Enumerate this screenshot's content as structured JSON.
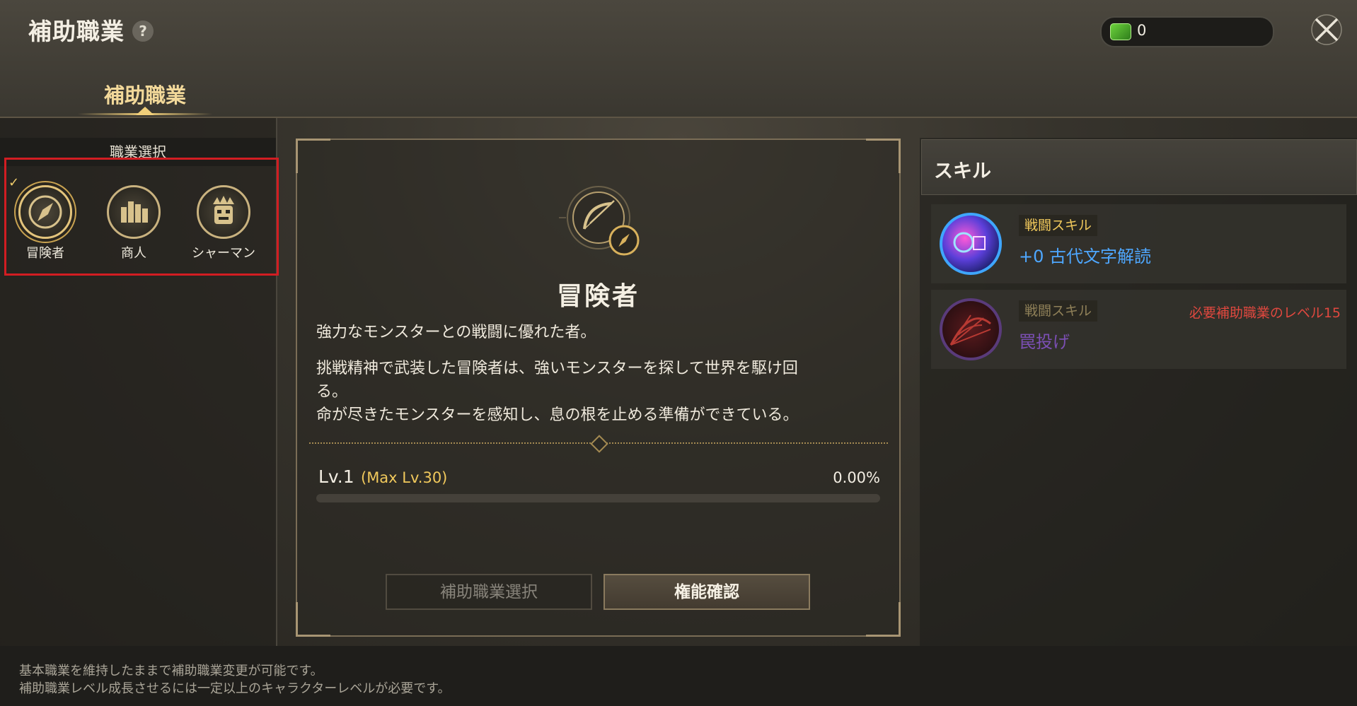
{
  "header": {
    "title": "補助職業",
    "help_icon": "question-icon",
    "help_label": "?",
    "currency_icon": "green-ticket-icon",
    "currency_value": "0",
    "close_icon": "close-icon"
  },
  "tabs": [
    {
      "label": "補助職業",
      "active": true
    }
  ],
  "class_select": {
    "title": "職業選択",
    "classes": [
      {
        "label": "冒険者",
        "icon": "compass-icon",
        "selected": true
      },
      {
        "label": "商人",
        "icon": "coins-icon",
        "selected": false
      },
      {
        "label": "シャーマン",
        "icon": "totem-mask-icon",
        "selected": false
      }
    ]
  },
  "detail": {
    "emblem_icon": "bow-compass-icon",
    "name": "冒険者",
    "short_description": "強力なモンスターとの戦闘に優れた者。",
    "long_description_lines": [
      "挑戦精神で武装した冒険者は、強いモンスターを探して世界を駆け回",
      "る。",
      "命が尽きたモンスターを感知し、息の根を止める準備ができている。"
    ],
    "level": "Lv.1",
    "max_level": "(Max Lv.30)",
    "progress_percent": "0.00%",
    "progress": 0,
    "buttons": {
      "select": "補助職業選択",
      "confirm": "権能確認"
    }
  },
  "skills": {
    "title": "スキル",
    "items": [
      {
        "tag": "戦闘スキル",
        "name": "+0 古代文字解読",
        "requirement": "",
        "locked": false,
        "icon": "ancient-script-icon"
      },
      {
        "tag": "戦闘スキル",
        "name": "罠投げ",
        "requirement": "必要補助職業のレベル15",
        "locked": true,
        "icon": "net-trap-icon"
      }
    ]
  },
  "footer": {
    "line1": "基本職業を維持したままで補助職業変更が可能です。",
    "line2": "補助職業レベル成長させるには一定以上のキャラクターレベルが必要です。"
  },
  "colors": {
    "accent_gold": "#f1c95c",
    "requirement_red": "#e0483f",
    "skill_blue": "#4ea7ff",
    "skill_locked_purple": "#7b4fb3"
  }
}
